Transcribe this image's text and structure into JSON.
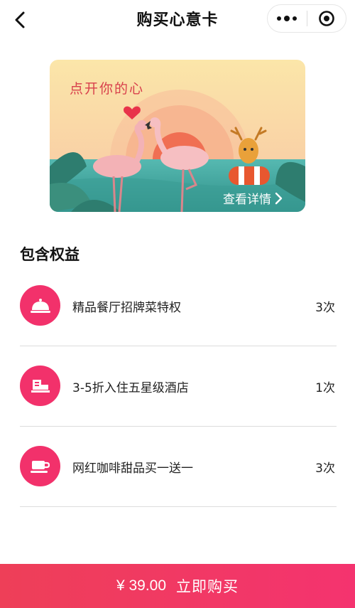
{
  "nav": {
    "title": "购买心意卡"
  },
  "card": {
    "slogan": "点开你的心",
    "detail_label": "查看详情"
  },
  "benefits": {
    "title": "包含权益",
    "items": [
      {
        "name": "精品餐厅招牌菜特权",
        "count": "3次",
        "icon": "dining-cloche-icon"
      },
      {
        "name": "3-5折入住五星级酒店",
        "count": "1次",
        "icon": "hotel-bed-icon"
      },
      {
        "name": "网红咖啡甜品买一送一",
        "count": "3次",
        "icon": "coffee-cup-icon"
      }
    ]
  },
  "buy": {
    "price": "¥ 39.00",
    "label": "立即购买"
  },
  "colors": {
    "accent": "#f2316b",
    "buy_bar": "#ef3a5f"
  }
}
